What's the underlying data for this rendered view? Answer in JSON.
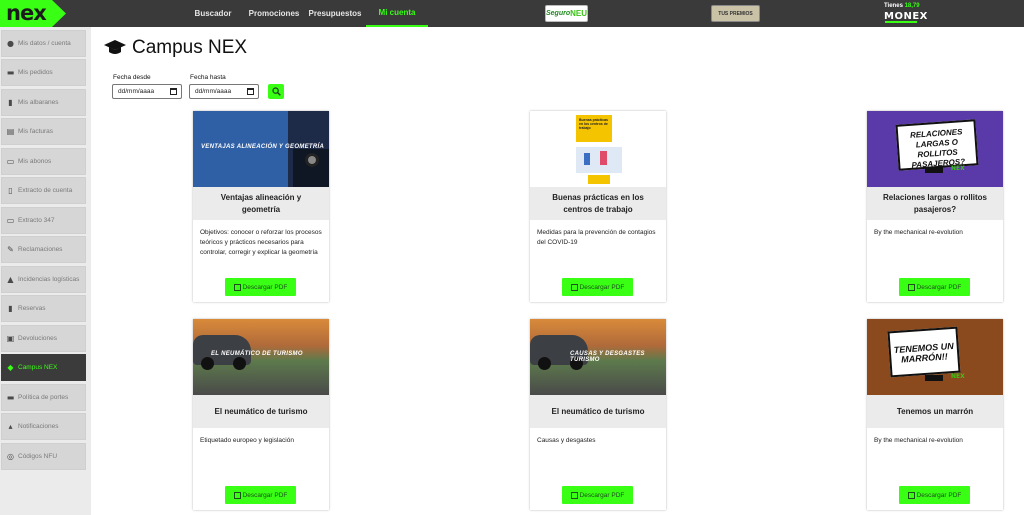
{
  "topbar": {
    "logo": "nex",
    "nav": [
      "Buscador",
      "Promociones",
      "Presupuestos",
      "Mi cuenta"
    ],
    "active_nav": "Mi cuenta",
    "seguro_a": "Seguro",
    "seguro_b": "NEU",
    "tus_premios": "TUS PREMIOS",
    "tienes_label": "Tienes",
    "tienes_amount": "18,79",
    "monex": "MONEX"
  },
  "sidebar": {
    "items": [
      {
        "label": "Mis datos / cuenta",
        "icon": "user-icon"
      },
      {
        "label": "Mis pedidos",
        "icon": "truck-icon"
      },
      {
        "label": "Mis albaranes",
        "icon": "bars-icon"
      },
      {
        "label": "Mis facturas",
        "icon": "invoice-icon"
      },
      {
        "label": "Mis abonos",
        "icon": "monitor-icon"
      },
      {
        "label": "Extracto de cuenta",
        "icon": "document-icon"
      },
      {
        "label": "Extracto 347",
        "icon": "tag-icon"
      },
      {
        "label": "Reclamaciones",
        "icon": "pencil-icon"
      },
      {
        "label": "Incidencias logísticas",
        "icon": "warning-icon"
      },
      {
        "label": "Reservas",
        "icon": "bookmark-icon"
      },
      {
        "label": "Devoluciones",
        "icon": "box-icon"
      },
      {
        "label": "Campus NEX",
        "icon": "graduation-cap-icon"
      },
      {
        "label": "Política de portes",
        "icon": "truck-icon"
      },
      {
        "label": "Notificaciones",
        "icon": "bell-icon"
      },
      {
        "label": "Códigos NFU",
        "icon": "circle-icon"
      }
    ],
    "active": "Campus NEX"
  },
  "main": {
    "title": "Campus NEX",
    "fecha_desde_label": "Fecha desde",
    "fecha_hasta_label": "Fecha hasta",
    "date_placeholder": "dd/mm/aaaa",
    "cards": [
      {
        "title": "Ventajas alineación y geometría",
        "desc": "Objetivos: conocer o reforzar los procesos teóricos y prácticos necesarios para controlar, corregir y explicar la geometría",
        "button": "Descargar PDF",
        "thumb_text": "VENTAJAS ALINEACIÓN Y GEOMETRÍA"
      },
      {
        "title": "Buenas prácticas en los centros de trabajo",
        "desc": "Medidas para la prevención de contagios del COVID-19",
        "button": "Descargar PDF",
        "thumb_text": "Buenas prácticas en los centros de trabajo"
      },
      {
        "title": "Relaciones largas o rollitos pasajeros?",
        "desc": "By the mechanical re-evolution",
        "button": "Descargar PDF",
        "thumb_text": "RELACIONES LARGAS O ROLLITOS PASAJEROS?"
      },
      {
        "title": "El neumático de turismo",
        "desc": "Etiquetado europeo y legislación",
        "button": "Descargar PDF",
        "thumb_text": "EL NEUMÁTICO DE TURISMO"
      },
      {
        "title": "El neumático de turismo",
        "desc": "Causas y desgastes",
        "button": "Descargar PDF",
        "thumb_text": "CAUSAS Y DESGASTES TURISMO"
      },
      {
        "title": "Tenemos un marrón",
        "desc": "By the mechanical re-evolution",
        "button": "Descargar PDF",
        "thumb_text": "TENEMOS UN MARRÓN!!"
      }
    ]
  }
}
